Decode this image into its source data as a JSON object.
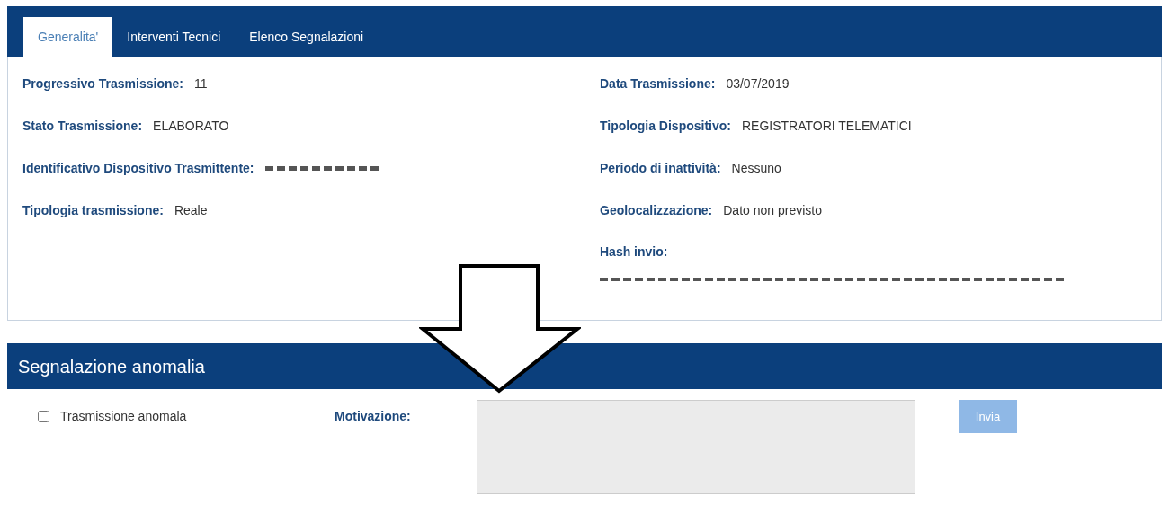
{
  "tabs": [
    {
      "label": "Generalita'",
      "selected": true
    },
    {
      "label": "Interventi Tecnici",
      "selected": false
    },
    {
      "label": "Elenco Segnalazioni",
      "selected": false
    }
  ],
  "details": {
    "left": [
      {
        "label": "Progressivo Trasmissione:",
        "value": "11"
      },
      {
        "label": "Stato Trasmissione:",
        "value": "ELABORATO"
      },
      {
        "label": "Identificativo Dispositivo Trasmittente:",
        "redacted": true
      },
      {
        "label": "Tipologia trasmissione:",
        "value": "Reale"
      }
    ],
    "right": [
      {
        "label": "Data Trasmissione:",
        "value": "03/07/2019"
      },
      {
        "label": "Tipologia Dispositivo:",
        "value": "REGISTRATORI TELEMATICI"
      },
      {
        "label": "Periodo di inattività:",
        "value": "Nessuno"
      },
      {
        "label": "Geolocalizzazione:",
        "value": "Dato non previsto"
      },
      {
        "label": "Hash invio:",
        "redacted": true,
        "stacked": true
      }
    ]
  },
  "anomaly": {
    "title": "Segnalazione anomalia",
    "checkbox": {
      "label": "Trasmissione anomala",
      "checked": false
    },
    "reason_label": "Motivazione:",
    "reason_field": {
      "disabled": true
    },
    "submit": {
      "label": "Invia",
      "disabled": true
    }
  }
}
